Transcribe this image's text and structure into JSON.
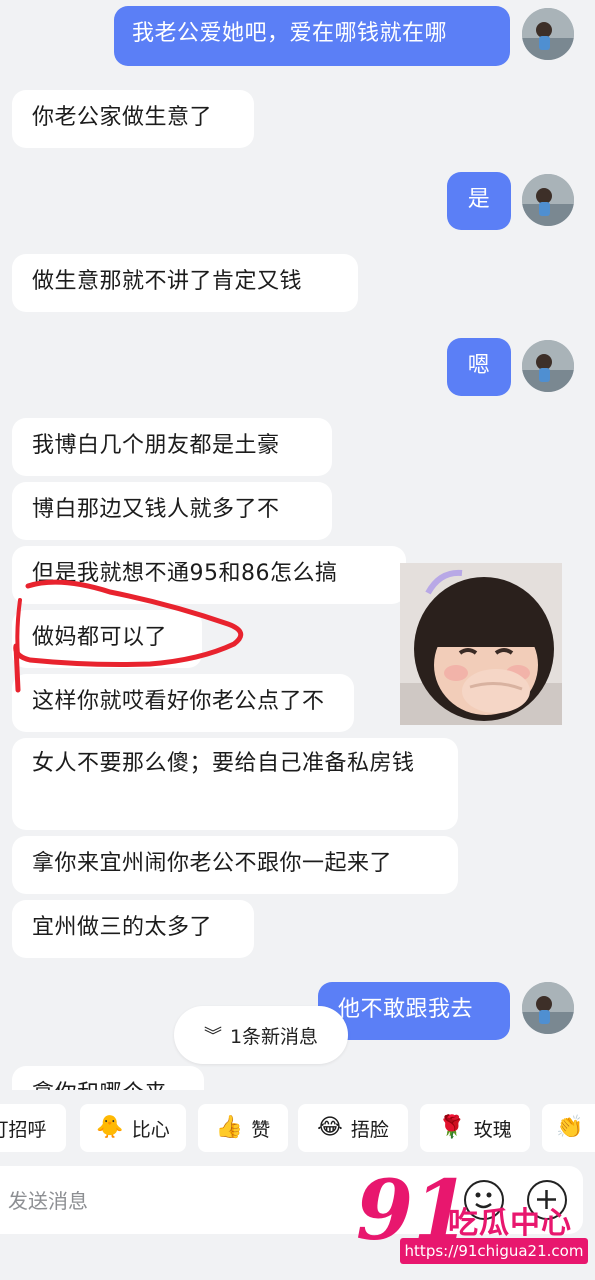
{
  "messages": {
    "m1": "我老公爱她吧，爱在哪钱就在哪",
    "m2": "你老公家做生意了",
    "m3": "是",
    "m4": "做生意那就不讲了肯定又钱",
    "m5": "嗯",
    "m6": "我博白几个朋友都是土豪",
    "m7": "博白那边又钱人就多了不",
    "m8": "但是我就想不通95和86怎么搞",
    "m9": "做妈都可以了",
    "m10": "这样你就哎看好你老公点了不",
    "m11": "女人不要那么傻；要给自己准备私房钱",
    "m12": "拿你来宜州闹你老公不跟你一起来了",
    "m13": "宜州做三的太多了",
    "m14": "他不敢跟我去",
    "m15": "拿你和哪个来"
  },
  "new_message_pill": "1条新消息",
  "quick_replies": [
    {
      "label": "打招呼",
      "icon": "wave-emoji"
    },
    {
      "label": "比心",
      "icon": "heart-hands-emoji"
    },
    {
      "label": "赞",
      "icon": "thumbs-up-emoji"
    },
    {
      "label": "捂脸",
      "icon": "facepalm-emoji"
    },
    {
      "label": "玫瑰",
      "icon": "rose-emoji"
    },
    {
      "label": "",
      "icon": "clap-emoji"
    }
  ],
  "input": {
    "placeholder": "发送消息"
  },
  "watermark": {
    "number": "91",
    "text": "吃瓜中心",
    "url": "https://91chigua21.com"
  },
  "colors": {
    "my_bubble": "#5b7ff6",
    "other_bubble": "#ffffff",
    "background": "#f1f2f4",
    "watermark": "#e8176e"
  }
}
